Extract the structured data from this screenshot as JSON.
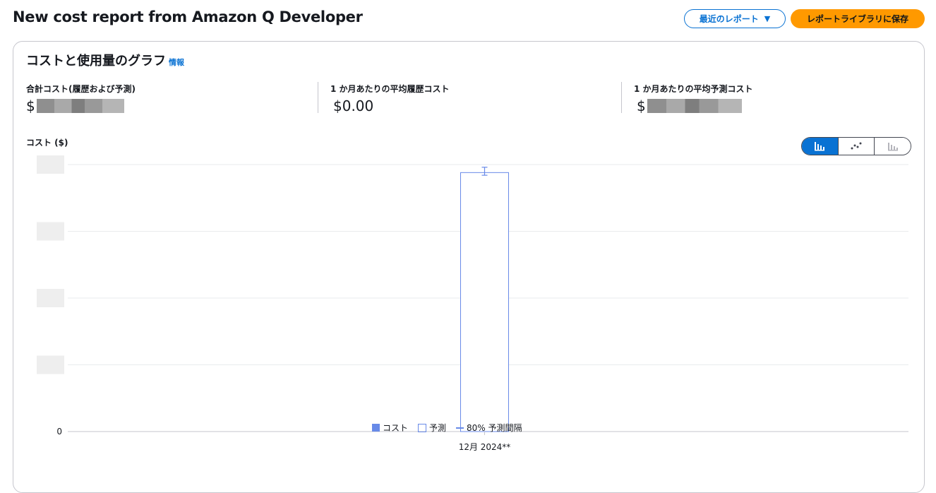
{
  "header": {
    "title": "New cost report from Amazon Q Developer",
    "recent_reports_label": "最近のレポート",
    "save_label": "レポートライブラリに保存"
  },
  "panel": {
    "title": "コストと使用量のグラフ",
    "info_label": "情報"
  },
  "kpis": [
    {
      "label": "合計コスト(履歴および予測)",
      "currency": "$",
      "value": ""
    },
    {
      "label": "1 か月あたりの平均履歴コスト",
      "currency": "",
      "value": "$0.00"
    },
    {
      "label": "1 か月あたりの平均予測コスト",
      "currency": "$",
      "value": ""
    }
  ],
  "chart_view_toggle": [
    "bar-chart-icon",
    "line-chart-icon",
    "stacked-bar-chart-icon"
  ],
  "chart_data": {
    "type": "bar",
    "ylabel": "コスト ($)",
    "categories": [
      "12月 2024**"
    ],
    "series": [
      {
        "name": "予測",
        "values": [
          0.97
        ],
        "style": "outlined"
      }
    ],
    "prediction_interval": {
      "name": "80% 予測間隔",
      "low": [
        0.96
      ],
      "high": [
        0.99
      ]
    },
    "y_ticks": [
      "",
      "",
      "",
      "",
      "0"
    ],
    "ylim": [
      0,
      1
    ],
    "grid": true,
    "legend": [
      {
        "name": "コスト",
        "kind": "filled"
      },
      {
        "name": "予測",
        "kind": "outlined"
      },
      {
        "name": "80% 予測間隔",
        "kind": "line"
      }
    ],
    "legend_position": "bottom",
    "color": "#688ae8"
  }
}
